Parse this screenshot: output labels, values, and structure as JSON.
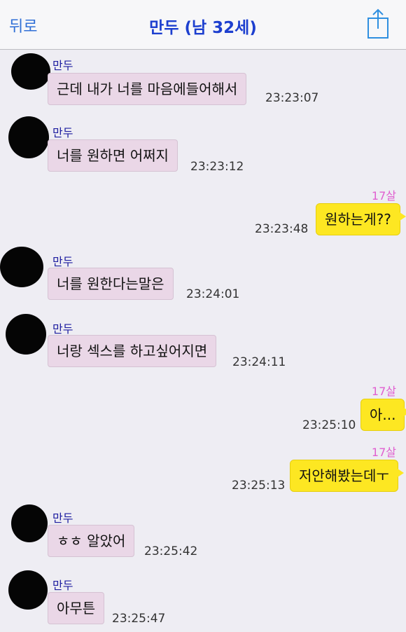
{
  "header": {
    "back_label": "뒤로",
    "title": "만두 (남 32세)"
  },
  "messages": [
    {
      "sender": "만두",
      "text": "근데 내가 너를 마음에들어해서",
      "time": "23:23:07"
    },
    {
      "sender": "만두",
      "text": "너를 원하면 어쩌지",
      "time": "23:23:12"
    },
    {
      "sender": "17살",
      "text": "원하는게??",
      "time": "23:23:48"
    },
    {
      "sender": "만두",
      "text": "너를 원한다는말은",
      "time": "23:24:01"
    },
    {
      "sender": "만두",
      "text": "너랑 섹스를 하고싶어지면",
      "time": "23:24:11"
    },
    {
      "sender": "17살",
      "text": "아...",
      "time": "23:25:10"
    },
    {
      "sender": "17살",
      "text": "저안해봤는데ㅜ",
      "time": "23:25:13"
    },
    {
      "sender": "만두",
      "text": "ㅎㅎ 알았어",
      "time": "23:25:42"
    },
    {
      "sender": "만두",
      "text": "아무튼",
      "time": "23:25:47"
    }
  ],
  "colors": {
    "header_title": "#1d3fcf",
    "back_link": "#2f6fd6",
    "incoming_bubble": "#ead7e7",
    "outgoing_bubble": "#fde722",
    "my_label": "#e060d0",
    "sender_name": "#1e1ea0"
  },
  "icons": {
    "share": "share-icon"
  }
}
